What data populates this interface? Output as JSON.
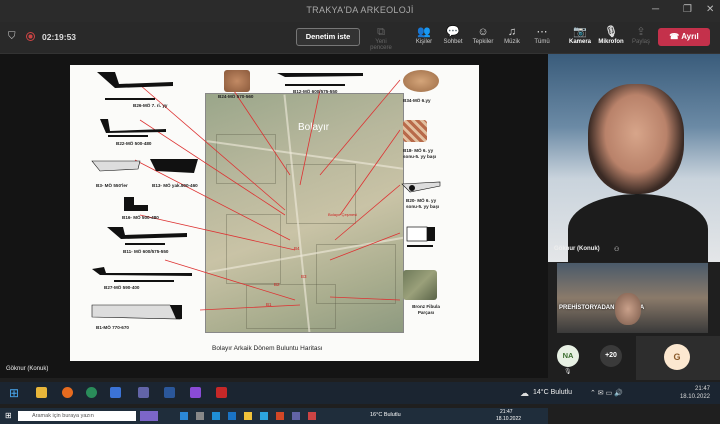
{
  "window": {
    "title": "TRAKYA'DA ARKEOLOJİ"
  },
  "meeting": {
    "timer": "02:19:53",
    "denetim_label": "Denetim iste",
    "yeni_pencere_label": "Yeni pencere",
    "kisiler_label": "Kişiler",
    "sohbet_label": "Sohbet",
    "tepkiler_label": "Tepkiler",
    "muzik_label": "Müzik",
    "tumu_label": "Tümü",
    "kamera_label": "Kamera",
    "mikrofon_label": "Mikrofon",
    "paylas_label": "Paylaş",
    "ayril_label": "Ayrıl",
    "accent": "#c4314b"
  },
  "slide": {
    "map_title": "Bolayır",
    "caption": "Bolayır Arkaik Dönem Buluntu Haritası",
    "map_labels": [
      "Bolayır Çeşmesi",
      "B4",
      "B1",
      "B2",
      "B3"
    ],
    "finds_left": [
      {
        "label": "B26-MÖ 7. ri. yy"
      },
      {
        "label": "B22-MÖ 500-480"
      },
      {
        "label": "B3- MÖ 550'ler"
      },
      {
        "label": "B13- MÖ yak.500-460"
      },
      {
        "label": "B16- MÖ 500-480"
      },
      {
        "label": "B11- MÖ 600/575-550"
      },
      {
        "label": "B27-MÖ 590-400"
      },
      {
        "label": "B1-MÖ 770-670"
      }
    ],
    "finds_top": [
      {
        "label": "B24-MÖ 570-560"
      },
      {
        "label": "B12-MÖ 600/575-550"
      }
    ],
    "finds_right": [
      {
        "label": "B34-MÖ 6.yy"
      },
      {
        "label": "B18- MÖ 6. yy sonu-5. yy başı"
      },
      {
        "label": "B20- MÖ 6. yy sonu-5. yy başı"
      },
      {
        "label": "Bronz Fibula Parçası"
      }
    ]
  },
  "presenter_taskbar": {
    "search_placeholder": "Aramak için buraya yazın",
    "weather": "16°C Bulutlu",
    "time": "21:47",
    "date": "18.10.2022"
  },
  "participants": {
    "bottom_left_name": "Göknur (Konuk)",
    "video_name": "Göknur (Konuk)",
    "thumb_banner": "PREHİSTORYADAN BİZANS'A",
    "na_initials": "NA",
    "more_count": "+20",
    "g_initials": "G"
  },
  "os_taskbar": {
    "weather": "14°C Bulutlu",
    "time": "21:47",
    "date": "18.10.2022"
  }
}
